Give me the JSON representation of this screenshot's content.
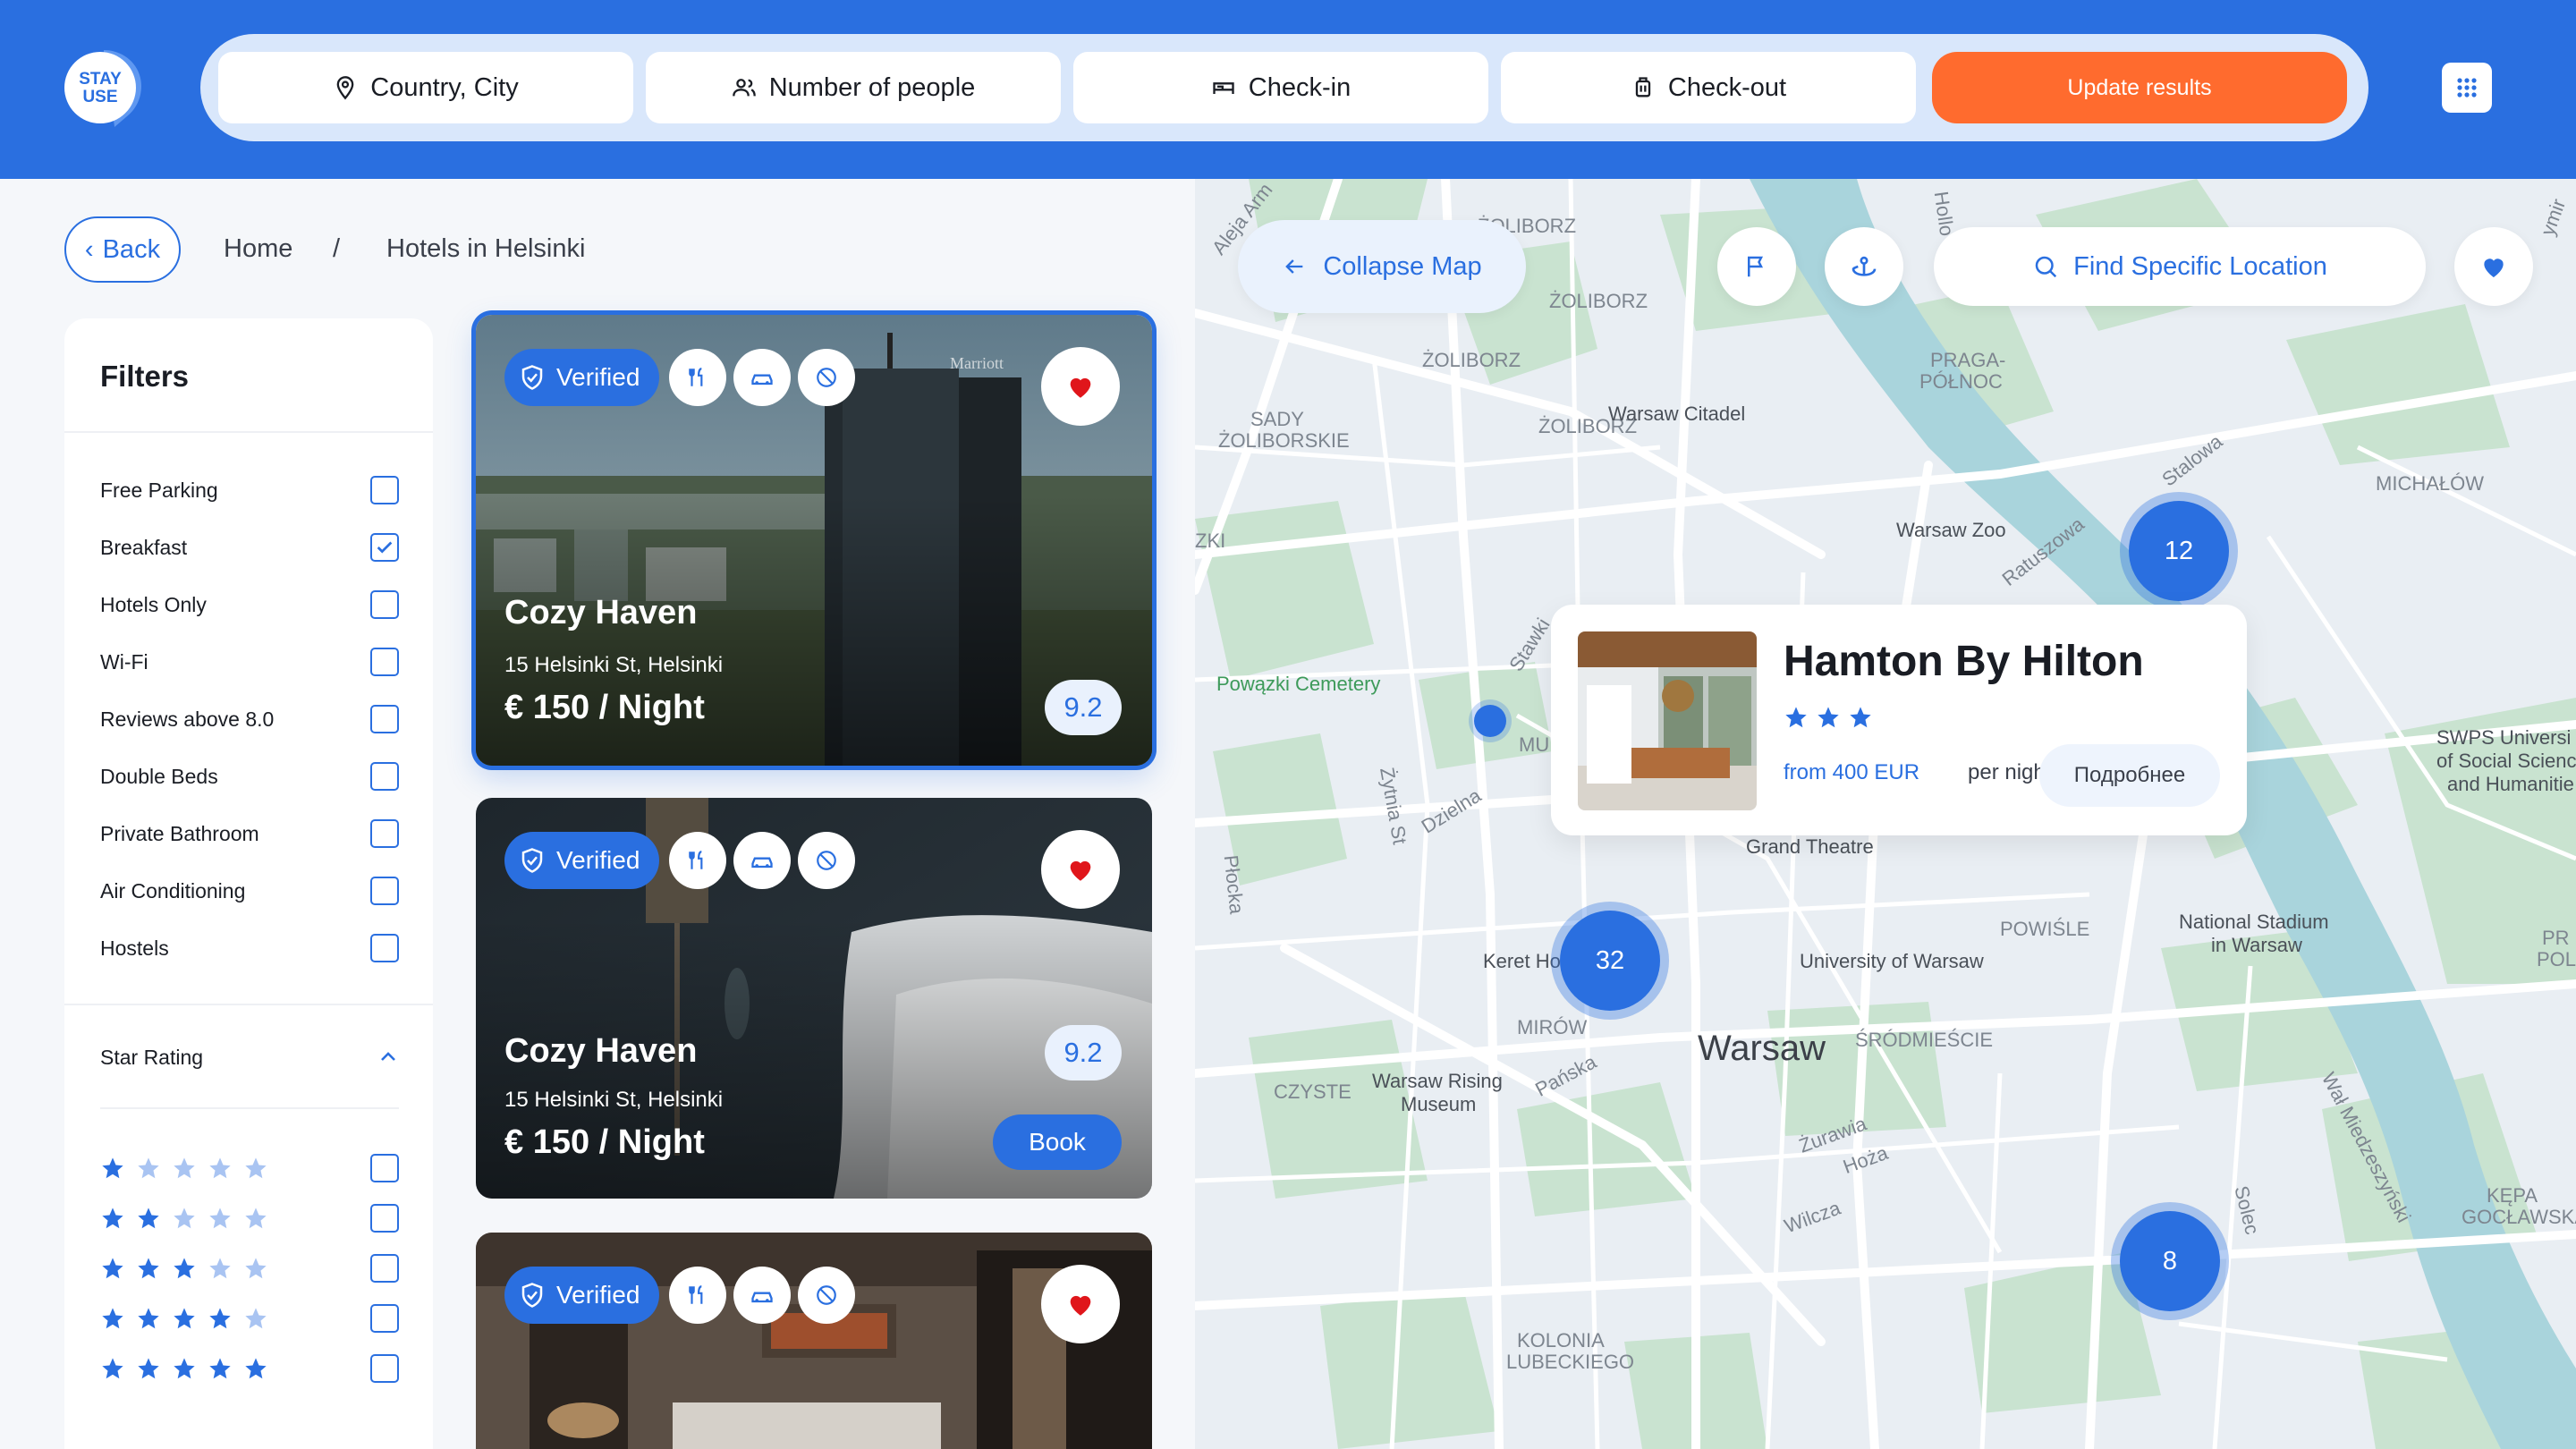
{
  "app": {
    "logo_text_1": "STAY",
    "logo_text_2": "USE"
  },
  "search": {
    "location": "Country, City",
    "people": "Number of people",
    "checkin": "Check-in",
    "checkout": "Check-out",
    "update": "Update results"
  },
  "breadcrumb": {
    "back": "Back",
    "home": "Home",
    "separator": "/",
    "current": "Hotels in Helsinki"
  },
  "filters": {
    "title": "Filters",
    "items": [
      {
        "label": "Free Parking",
        "checked": false
      },
      {
        "label": "Breakfast",
        "checked": true
      },
      {
        "label": "Hotels Only",
        "checked": false
      },
      {
        "label": "Wi-Fi",
        "checked": false
      },
      {
        "label": "Reviews above 8.0",
        "checked": false
      },
      {
        "label": "Double Beds",
        "checked": false
      },
      {
        "label": "Private Bathroom",
        "checked": false
      },
      {
        "label": "Air Conditioning",
        "checked": false
      },
      {
        "label": "Hostels",
        "checked": false
      }
    ],
    "star_rating_title": "Star Rating",
    "star_rows": [
      1,
      2,
      3,
      4,
      5
    ]
  },
  "cards": [
    {
      "verified": "Verified",
      "name": "Cozy Haven",
      "address": "15 Helsinki St, Helsinki",
      "price": "€ 150 / Night",
      "score": "9.2"
    },
    {
      "verified": "Verified",
      "name": "Cozy Haven",
      "address": "15 Helsinki St, Helsinki",
      "price": "€ 150 / Night",
      "score": "9.2",
      "book": "Book"
    },
    {
      "verified": "Verified"
    }
  ],
  "map": {
    "collapse": "Collapse Map",
    "find": "Find Specific Location",
    "clusters": [
      "12",
      "32",
      "8"
    ],
    "labels": {
      "zoliborz1": "ŻOLIBORZ",
      "zoliborz2": "ŻOLIBORZ",
      "zoliborz3": "ŻOLIBORZ",
      "zoliborz4": "ŻOLIBORZ",
      "sady": "SADY",
      "sady2": "ŻOLIBORSKIE",
      "citadel": "Warsaw Citadel",
      "praga": "PRAGA-",
      "praga2": "PÓŁNOC",
      "michalow": "MICHAŁÓW",
      "zoo": "Warsaw Zoo",
      "stalowa": "Stalowa",
      "ratuszowa": "Ratuszowa",
      "zki": "ZKI",
      "powazki": "Powązki Cemetery",
      "stawki": "Stawki",
      "dzielna": "Dzielna",
      "zytnia": "Żytnia St",
      "plocka": "Płocka",
      "mu": "MU",
      "grand": "Grand Theatre",
      "powisle": "POWIŚLE",
      "stadium": "National Stadium",
      "stadium2": "in Warsaw",
      "swps": "SWPS Universi",
      "swps2": "of Social Scienc",
      "swps3": "and Humanitie",
      "pr": "PR",
      "pol": "POL",
      "keret": "Keret Ho",
      "univ": "University of Warsaw",
      "mirow": "MIRÓW",
      "warsaw": "Warsaw",
      "srodmiescie": "ŚRÓDMIEŚCIE",
      "czyste": "CZYSTE",
      "rising": "Warsaw Rising",
      "rising2": "Museum",
      "panska": "Pańska",
      "zurawia": "Żurawia",
      "hoza": "Hoża",
      "wilcza": "Wilcza",
      "walm": "Wał Miedzeszyński",
      "solec": "Solec",
      "kepa": "KĘPA",
      "kepa2": "GOCŁAWSKA",
      "kolonia": "KOLONIA",
      "kolonia2": "LUBECKIEGO",
      "aleja": "Aleja Arm",
      "hollo": "Hollo",
      "zymirs": "ymir"
    }
  },
  "popup": {
    "title": "Hamton By Hilton",
    "stars": 3,
    "from": "from 400 EUR",
    "per": "per night",
    "more": "Подробнее"
  },
  "colors": {
    "primary": "#2a6fe0",
    "accent": "#ff6b2e",
    "heart": "#e0161b"
  }
}
